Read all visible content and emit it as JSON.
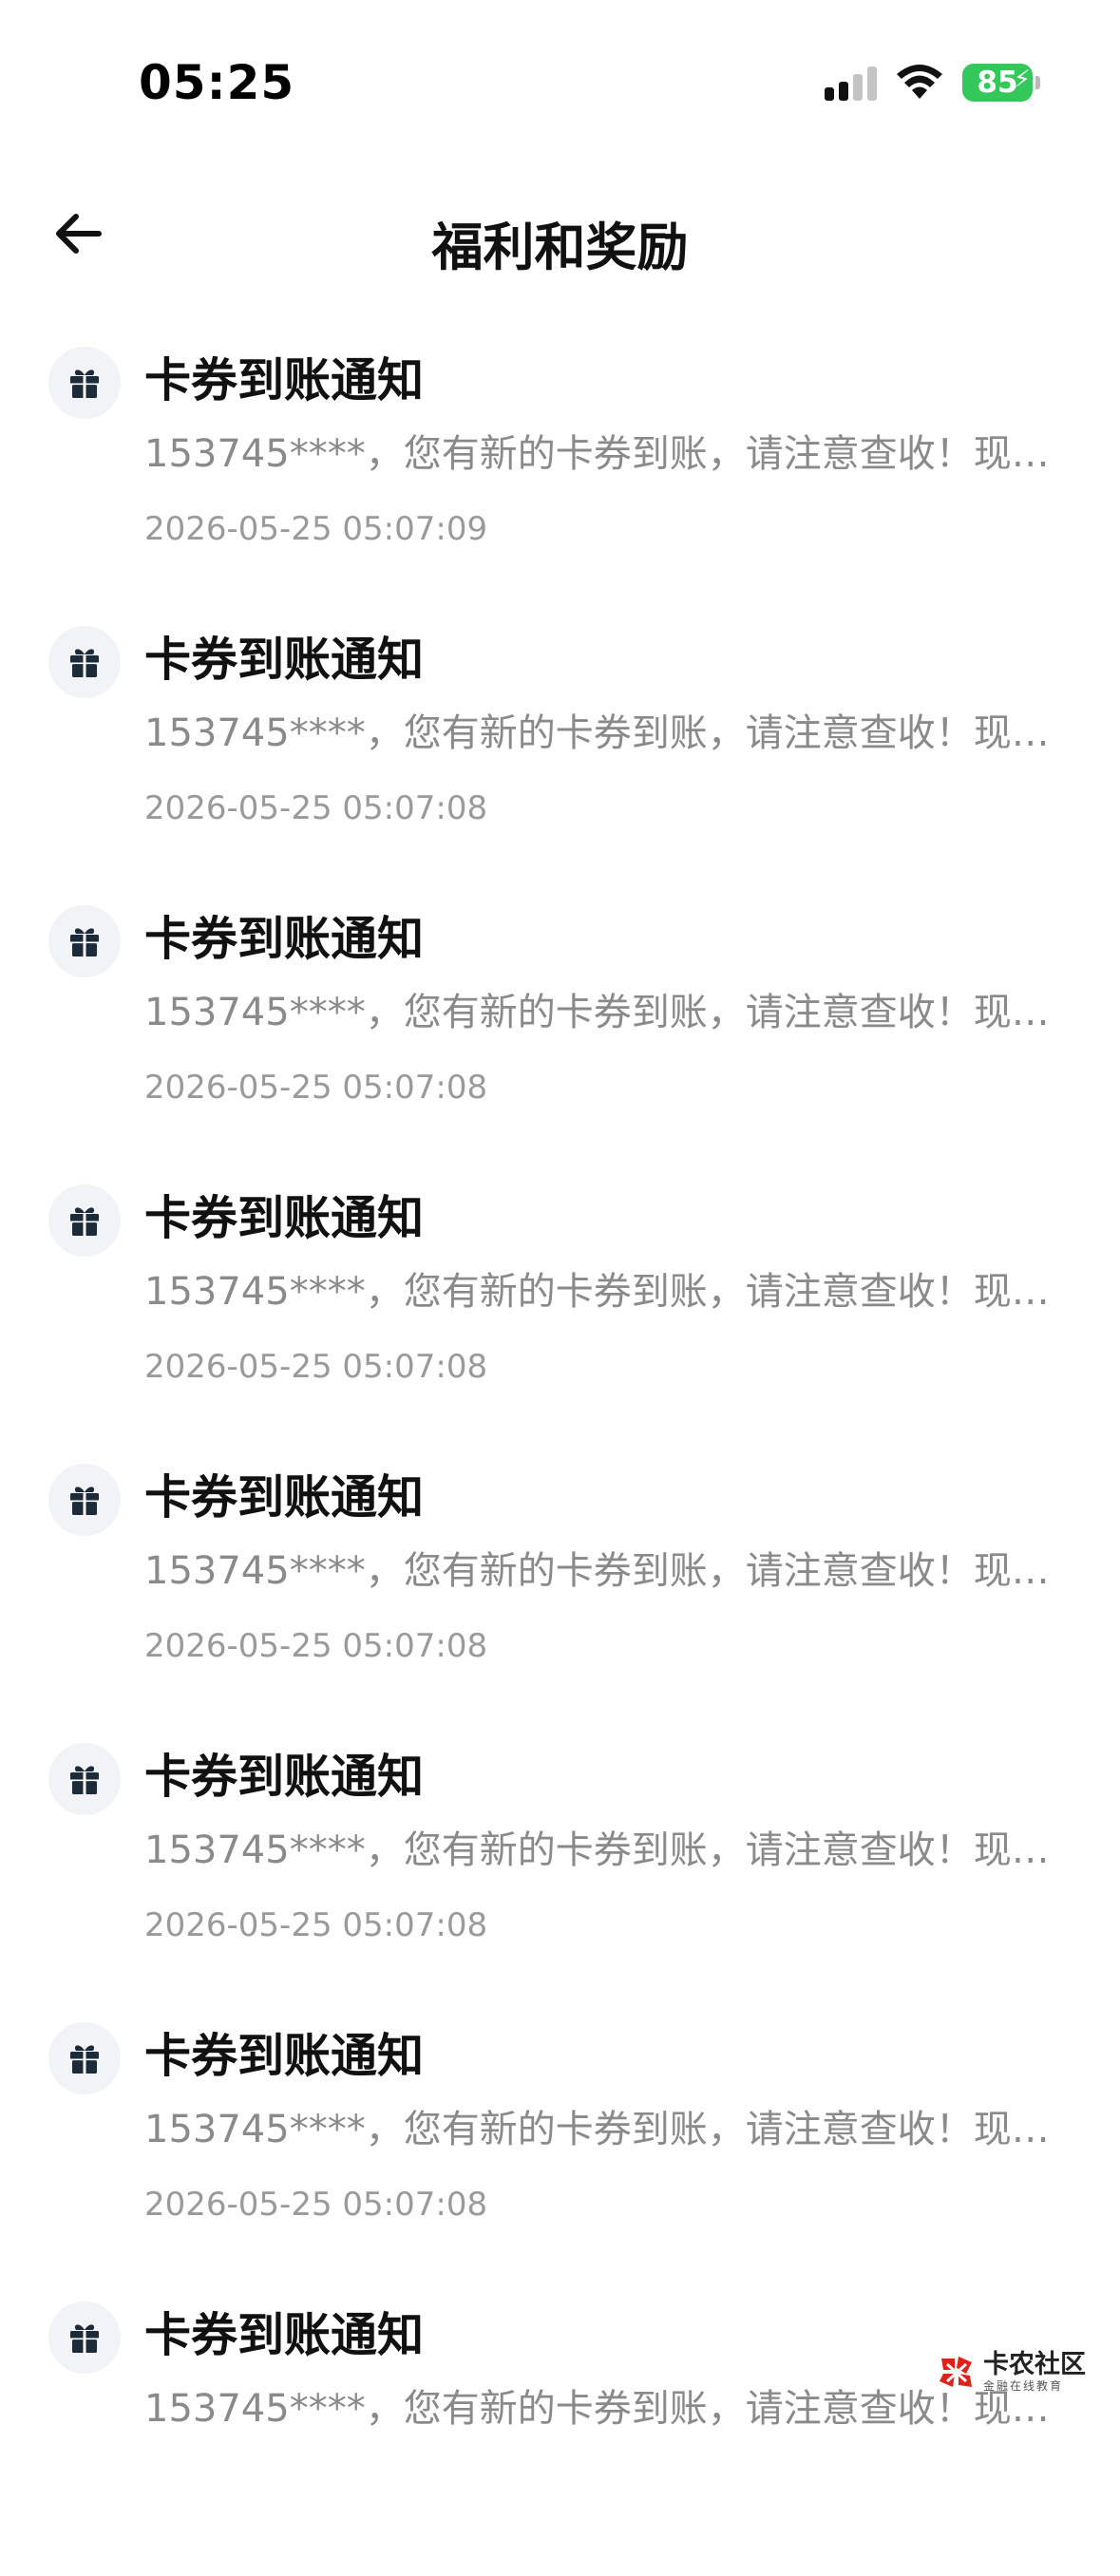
{
  "status_bar": {
    "time": "05:25",
    "battery": "85"
  },
  "header": {
    "title": "福利和奖励"
  },
  "notifications": [
    {
      "title": "卡券到账通知",
      "body": "153745****，您有新的卡券到账，请注意查收！现金券",
      "time": "2026-05-25 05:07:09"
    },
    {
      "title": "卡券到账通知",
      "body": "153745****，您有新的卡券到账，请注意查收！现金券",
      "time": "2026-05-25 05:07:08"
    },
    {
      "title": "卡券到账通知",
      "body": "153745****，您有新的卡券到账，请注意查收！现金券",
      "time": "2026-05-25 05:07:08"
    },
    {
      "title": "卡券到账通知",
      "body": "153745****，您有新的卡券到账，请注意查收！现金券",
      "time": "2026-05-25 05:07:08"
    },
    {
      "title": "卡券到账通知",
      "body": "153745****，您有新的卡券到账，请注意查收！现金券",
      "time": "2026-05-25 05:07:08"
    },
    {
      "title": "卡券到账通知",
      "body": "153745****，您有新的卡券到账，请注意查收！现金券",
      "time": "2026-05-25 05:07:08"
    },
    {
      "title": "卡券到账通知",
      "body": "153745****，您有新的卡券到账，请注意查收！现金券",
      "time": "2026-05-25 05:07:08"
    },
    {
      "title": "卡券到账通知",
      "body": "153745****，您有新的卡券到账，请注意查收！现金券",
      "time": ""
    }
  ],
  "watermark": {
    "title": "卡农社区",
    "subtitle": "金融在线教育"
  },
  "icons": {
    "back": "arrow-left-icon",
    "notification": "gift-icon"
  },
  "colors": {
    "gift_icon": "#1c2b3a",
    "icon_bg": "#f1f3f6",
    "battery": "#34c759",
    "body_text": "#8a8a8a"
  }
}
